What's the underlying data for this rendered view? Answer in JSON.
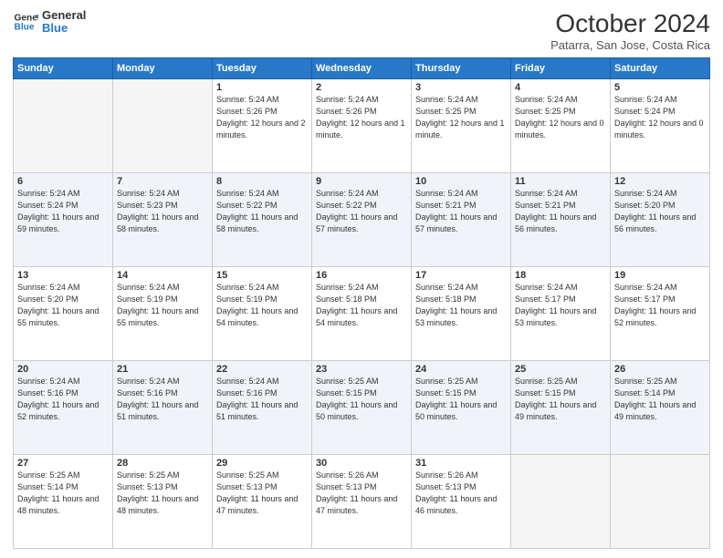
{
  "logo": {
    "line1": "General",
    "line2": "Blue"
  },
  "title": "October 2024",
  "location": "Patarra, San Jose, Costa Rica",
  "weekdays": [
    "Sunday",
    "Monday",
    "Tuesday",
    "Wednesday",
    "Thursday",
    "Friday",
    "Saturday"
  ],
  "weeks": [
    [
      {
        "day": "",
        "empty": true
      },
      {
        "day": "",
        "empty": true
      },
      {
        "day": "1",
        "sunrise": "5:24 AM",
        "sunset": "5:26 PM",
        "daylight": "12 hours and 2 minutes."
      },
      {
        "day": "2",
        "sunrise": "5:24 AM",
        "sunset": "5:26 PM",
        "daylight": "12 hours and 1 minute."
      },
      {
        "day": "3",
        "sunrise": "5:24 AM",
        "sunset": "5:25 PM",
        "daylight": "12 hours and 1 minute."
      },
      {
        "day": "4",
        "sunrise": "5:24 AM",
        "sunset": "5:25 PM",
        "daylight": "12 hours and 0 minutes."
      },
      {
        "day": "5",
        "sunrise": "5:24 AM",
        "sunset": "5:24 PM",
        "daylight": "12 hours and 0 minutes."
      }
    ],
    [
      {
        "day": "6",
        "sunrise": "5:24 AM",
        "sunset": "5:24 PM",
        "daylight": "11 hours and 59 minutes."
      },
      {
        "day": "7",
        "sunrise": "5:24 AM",
        "sunset": "5:23 PM",
        "daylight": "11 hours and 58 minutes."
      },
      {
        "day": "8",
        "sunrise": "5:24 AM",
        "sunset": "5:22 PM",
        "daylight": "11 hours and 58 minutes."
      },
      {
        "day": "9",
        "sunrise": "5:24 AM",
        "sunset": "5:22 PM",
        "daylight": "11 hours and 57 minutes."
      },
      {
        "day": "10",
        "sunrise": "5:24 AM",
        "sunset": "5:21 PM",
        "daylight": "11 hours and 57 minutes."
      },
      {
        "day": "11",
        "sunrise": "5:24 AM",
        "sunset": "5:21 PM",
        "daylight": "11 hours and 56 minutes."
      },
      {
        "day": "12",
        "sunrise": "5:24 AM",
        "sunset": "5:20 PM",
        "daylight": "11 hours and 56 minutes."
      }
    ],
    [
      {
        "day": "13",
        "sunrise": "5:24 AM",
        "sunset": "5:20 PM",
        "daylight": "11 hours and 55 minutes."
      },
      {
        "day": "14",
        "sunrise": "5:24 AM",
        "sunset": "5:19 PM",
        "daylight": "11 hours and 55 minutes."
      },
      {
        "day": "15",
        "sunrise": "5:24 AM",
        "sunset": "5:19 PM",
        "daylight": "11 hours and 54 minutes."
      },
      {
        "day": "16",
        "sunrise": "5:24 AM",
        "sunset": "5:18 PM",
        "daylight": "11 hours and 54 minutes."
      },
      {
        "day": "17",
        "sunrise": "5:24 AM",
        "sunset": "5:18 PM",
        "daylight": "11 hours and 53 minutes."
      },
      {
        "day": "18",
        "sunrise": "5:24 AM",
        "sunset": "5:17 PM",
        "daylight": "11 hours and 53 minutes."
      },
      {
        "day": "19",
        "sunrise": "5:24 AM",
        "sunset": "5:17 PM",
        "daylight": "11 hours and 52 minutes."
      }
    ],
    [
      {
        "day": "20",
        "sunrise": "5:24 AM",
        "sunset": "5:16 PM",
        "daylight": "11 hours and 52 minutes."
      },
      {
        "day": "21",
        "sunrise": "5:24 AM",
        "sunset": "5:16 PM",
        "daylight": "11 hours and 51 minutes."
      },
      {
        "day": "22",
        "sunrise": "5:24 AM",
        "sunset": "5:16 PM",
        "daylight": "11 hours and 51 minutes."
      },
      {
        "day": "23",
        "sunrise": "5:25 AM",
        "sunset": "5:15 PM",
        "daylight": "11 hours and 50 minutes."
      },
      {
        "day": "24",
        "sunrise": "5:25 AM",
        "sunset": "5:15 PM",
        "daylight": "11 hours and 50 minutes."
      },
      {
        "day": "25",
        "sunrise": "5:25 AM",
        "sunset": "5:15 PM",
        "daylight": "11 hours and 49 minutes."
      },
      {
        "day": "26",
        "sunrise": "5:25 AM",
        "sunset": "5:14 PM",
        "daylight": "11 hours and 49 minutes."
      }
    ],
    [
      {
        "day": "27",
        "sunrise": "5:25 AM",
        "sunset": "5:14 PM",
        "daylight": "11 hours and 48 minutes."
      },
      {
        "day": "28",
        "sunrise": "5:25 AM",
        "sunset": "5:13 PM",
        "daylight": "11 hours and 48 minutes."
      },
      {
        "day": "29",
        "sunrise": "5:25 AM",
        "sunset": "5:13 PM",
        "daylight": "11 hours and 47 minutes."
      },
      {
        "day": "30",
        "sunrise": "5:26 AM",
        "sunset": "5:13 PM",
        "daylight": "11 hours and 47 minutes."
      },
      {
        "day": "31",
        "sunrise": "5:26 AM",
        "sunset": "5:13 PM",
        "daylight": "11 hours and 46 minutes."
      },
      {
        "day": "",
        "empty": true
      },
      {
        "day": "",
        "empty": true
      }
    ]
  ]
}
